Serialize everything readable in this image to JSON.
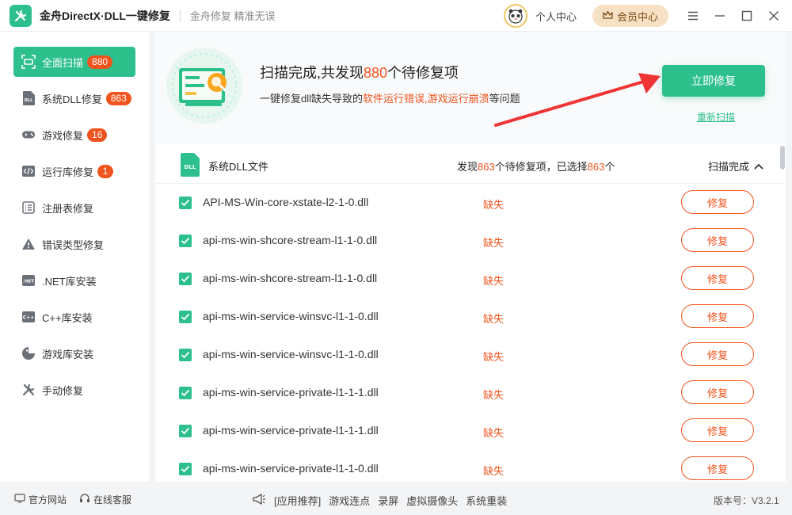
{
  "app": {
    "title": "金舟DirectX·DLL一键修复",
    "slogan": "金舟修复 精准无误",
    "user_center": "个人中心",
    "vip": "会员中心"
  },
  "sidebar": {
    "items": [
      {
        "label": "全面扫描",
        "badge": "880",
        "icon": "scan-icon",
        "active": true
      },
      {
        "label": "系统DLL修复",
        "badge": "863",
        "icon": "dll-icon"
      },
      {
        "label": "游戏修复",
        "badge": "16",
        "icon": "gamepad-icon"
      },
      {
        "label": "运行库修复",
        "badge": "1",
        "icon": "runtime-icon"
      },
      {
        "label": "注册表修复",
        "badge": "",
        "icon": "registry-icon"
      },
      {
        "label": "错误类型修复",
        "badge": "",
        "icon": "warning-icon"
      },
      {
        "label": ".NET库安装",
        "badge": "",
        "icon": "dotnet-icon"
      },
      {
        "label": "C++库安装",
        "badge": "",
        "icon": "cpp-icon"
      },
      {
        "label": "游戏库安装",
        "badge": "",
        "icon": "game-lib-icon"
      },
      {
        "label": "手动修复",
        "badge": "",
        "icon": "tools-icon"
      }
    ]
  },
  "summary": {
    "title_pre": "扫描完成,共发现",
    "title_count": "880",
    "title_post": "个待修复项",
    "desc_pre": "一键修复dll缺失导致的",
    "desc_hl1": "软件运行错误",
    "desc_sep": ",",
    "desc_hl2": "游戏运行崩溃",
    "desc_post": "等问题",
    "fix_now": "立即修复",
    "rescan": "重新扫描"
  },
  "group": {
    "title": "系统DLL文件",
    "found_pre": "发现",
    "found_count": "863",
    "found_mid": "个待修复项，已选择",
    "selected_count": "863",
    "found_post": "个",
    "status": "扫描完成"
  },
  "files": [
    {
      "name": "API-MS-Win-core-xstate-l2-1-0.dll",
      "status": "缺失",
      "action": "修复"
    },
    {
      "name": "api-ms-win-shcore-stream-l1-1-0.dll",
      "status": "缺失",
      "action": "修复"
    },
    {
      "name": "api-ms-win-shcore-stream-l1-1-0.dll",
      "status": "缺失",
      "action": "修复"
    },
    {
      "name": "api-ms-win-service-winsvc-l1-1-0.dll",
      "status": "缺失",
      "action": "修复"
    },
    {
      "name": "api-ms-win-service-winsvc-l1-1-0.dll",
      "status": "缺失",
      "action": "修复"
    },
    {
      "name": "api-ms-win-service-private-l1-1-1.dll",
      "status": "缺失",
      "action": "修复"
    },
    {
      "name": "api-ms-win-service-private-l1-1-1.dll",
      "status": "缺失",
      "action": "修复"
    },
    {
      "name": "api-ms-win-service-private-l1-1-0.dll",
      "status": "缺失",
      "action": "修复"
    }
  ],
  "footer": {
    "website": "官方网站",
    "support": "在线客服",
    "recommend": "[应用推荐]",
    "links": [
      "游戏连点",
      "录屏",
      "虚拟摄像头",
      "系统重装"
    ],
    "version": "版本号：V3.2.1"
  },
  "colors": {
    "accent": "#2dc08d",
    "warning": "#f0531d",
    "vip_bg": "#f7e1c4"
  }
}
